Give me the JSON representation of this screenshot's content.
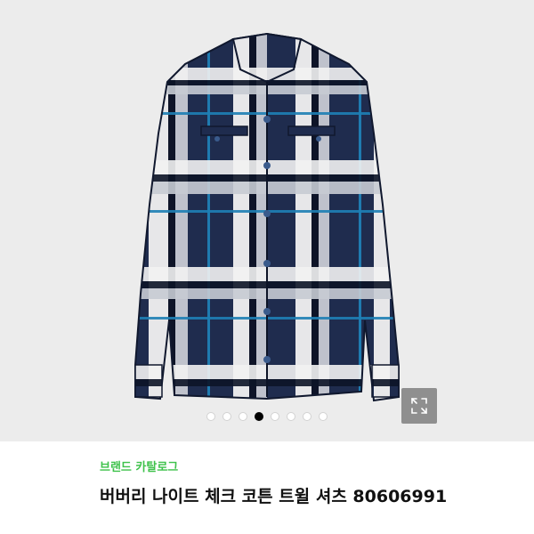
{
  "gallery": {
    "image_alt": "Burberry check cotton twill shirt",
    "slide_count": 8,
    "active_slide": 4,
    "expand_icon": "expand-arrows-icon"
  },
  "product": {
    "brand_link": "브랜드 카탈로그",
    "title": "버버리 나이트 체크 코튼 트윌 셔츠 80606991"
  },
  "colors": {
    "brand_green": "#3ec24b",
    "shirt_navy": "#1f2c4e",
    "check_blue": "#1e7fb5",
    "background_gray": "#ececec"
  }
}
